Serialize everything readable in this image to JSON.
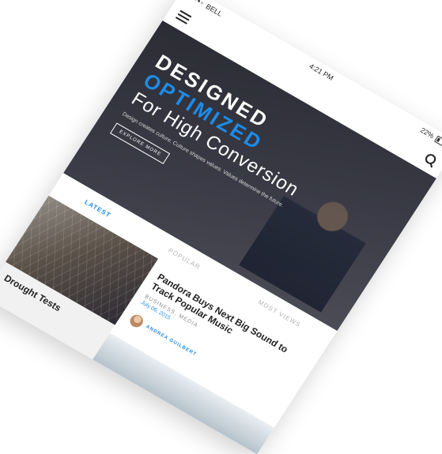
{
  "status_bar": {
    "signal": "••••◦",
    "carrier": "BELL",
    "time": "4:21 PM",
    "battery": "22%"
  },
  "navbar": {
    "menu_icon": "hamburger-menu-icon",
    "search_icon": "search-icon"
  },
  "hero": {
    "line1": "DESIGNED",
    "line2": "OPTIMIZED",
    "line3": "For High Conversion",
    "subtitle": "Design creates culture. Culture shapes values. Values determine the future.",
    "button": "EXPLORE MORE"
  },
  "tabs": [
    {
      "label": "LATEST",
      "active": true
    },
    {
      "label": "POPULAR",
      "active": false
    },
    {
      "label": "MOST VIEWS",
      "active": false
    }
  ],
  "left_card": {
    "title": "Drought Tests"
  },
  "article": {
    "title": "Pandora Buys Next Big Sound to Track Popular Music",
    "category": "BUSINESS, MEDIA",
    "date": "July 06, 2015",
    "author": "ANDREA GUILBERT"
  },
  "colors": {
    "accent": "#1e8be6",
    "hero_bg": "#2b2c34",
    "tab_inactive": "#b2b2b2"
  }
}
